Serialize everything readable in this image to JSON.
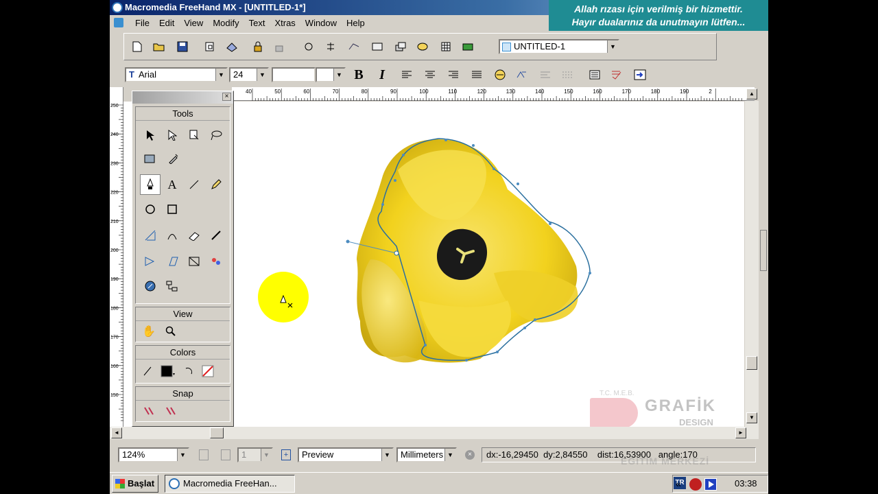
{
  "window": {
    "title": "Macromedia FreeHand MX - [UNTITLED-1*]"
  },
  "banner": {
    "line1": "Allah rızası için verilmiş bir hizmettir.",
    "line2": "Hayır dualarınız da unutmayın lütfen..."
  },
  "menu": {
    "items": [
      "File",
      "Edit",
      "View",
      "Modify",
      "Text",
      "Xtras",
      "Window",
      "Help"
    ]
  },
  "toolbar": {
    "document_select": "UNTITLED-1",
    "font_name": "Arial",
    "font_size": "24",
    "bold_label": "B",
    "italic_label": "I"
  },
  "ruler": {
    "horizontal": [
      "40",
      "50",
      "60",
      "70",
      "80",
      "90",
      "100",
      "110",
      "120",
      "130",
      "140",
      "150",
      "160",
      "170",
      "180",
      "190",
      "2"
    ],
    "vertical": [
      "250",
      "240",
      "230",
      "220",
      "210",
      "200",
      "190",
      "180",
      "170",
      "160",
      "150"
    ]
  },
  "tools_panel": {
    "tools_title": "Tools",
    "view_title": "View",
    "colors_title": "Colors",
    "snap_title": "Snap"
  },
  "status": {
    "zoom": "124%",
    "page": "1",
    "view_mode": "Preview",
    "units": "Millimeters",
    "readout": "dx:-16,29450  dy:2,84550    dist:16,53900   angle:170"
  },
  "watermark": {
    "org": "T.C. M.E.B.",
    "brand": "GRAFİK",
    "line2": "DESIGN",
    "line3": "EĞİTİM MERKEZİ"
  },
  "taskbar": {
    "start_label": "Başlat",
    "app_button": "Macromedia FreeHan...",
    "lang": "TR",
    "chevron": "«",
    "clock": "03:38"
  },
  "colors": {
    "title_start": "#0a246a",
    "banner_bg": "#1f8c93",
    "flower": "#f2d21e",
    "path": "#2a6f9e",
    "cursor_highlight": "#ffff00"
  }
}
